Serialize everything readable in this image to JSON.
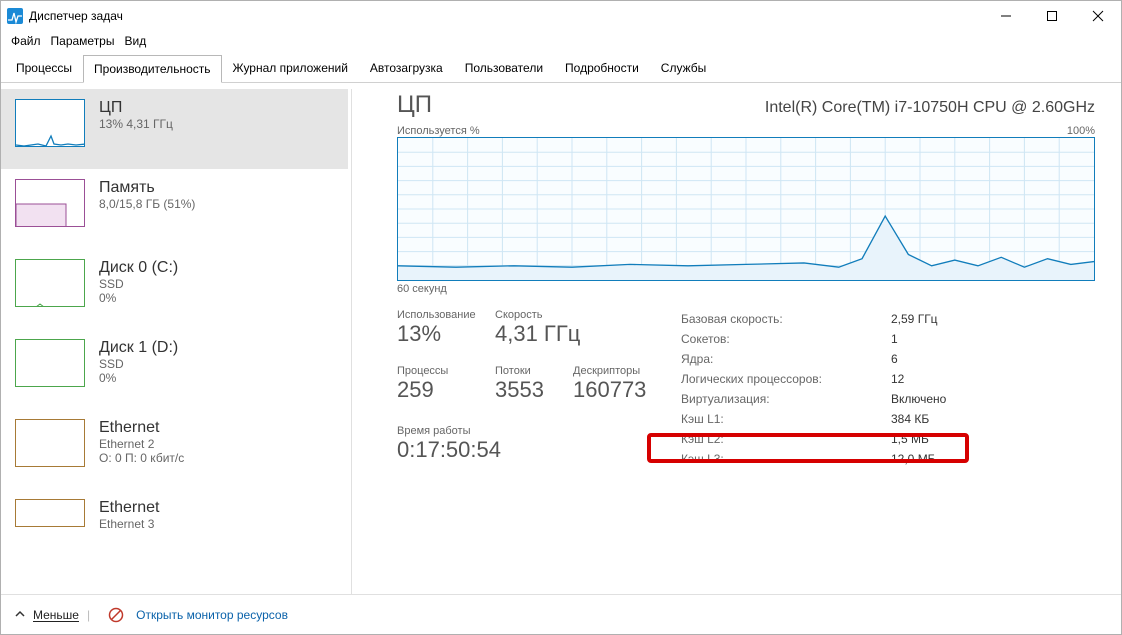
{
  "window": {
    "title": "Диспетчер задач"
  },
  "menu": {
    "file": "Файл",
    "options": "Параметры",
    "view": "Вид"
  },
  "tabs": {
    "processes": "Процессы",
    "performance": "Производительность",
    "apphistory": "Журнал приложений",
    "startup": "Автозагрузка",
    "users": "Пользователи",
    "details": "Подробности",
    "services": "Службы"
  },
  "sidebar": [
    {
      "name": "cpu",
      "title": "ЦП",
      "sub1": "13% 4,31 ГГц",
      "sub2": ""
    },
    {
      "name": "mem",
      "title": "Память",
      "sub1": "8,0/15,8 ГБ (51%)",
      "sub2": ""
    },
    {
      "name": "disk0",
      "title": "Диск 0 (C:)",
      "sub1": "SSD",
      "sub2": "0%"
    },
    {
      "name": "disk1",
      "title": "Диск 1 (D:)",
      "sub1": "SSD",
      "sub2": "0%"
    },
    {
      "name": "eth2",
      "title": "Ethernet",
      "sub1": "Ethernet 2",
      "sub2": "О: 0 П: 0 кбит/с"
    },
    {
      "name": "eth3",
      "title": "Ethernet",
      "sub1": "Ethernet 3",
      "sub2": ""
    }
  ],
  "cpu": {
    "heading": "ЦП",
    "model": "Intel(R) Core(TM) i7-10750H CPU @ 2.60GHz",
    "util_label": "Используется %",
    "util_max": "100%",
    "time_axis": "60 секунд",
    "stats": {
      "usage_label": "Использование",
      "usage_value": "13%",
      "speed_label": "Скорость",
      "speed_value": "4,31 ГГц",
      "proc_label": "Процессы",
      "proc_value": "259",
      "thread_label": "Потоки",
      "thread_value": "3553",
      "handle_label": "Дескрипторы",
      "handle_value": "160773",
      "uptime_label": "Время работы",
      "uptime_value": "0:17:50:54"
    },
    "props": {
      "base_label": "Базовая скорость:",
      "base_value": "2,59 ГГц",
      "sockets_label": "Сокетов:",
      "sockets_value": "1",
      "cores_label": "Ядра:",
      "cores_value": "6",
      "lp_label": "Логических процессоров:",
      "lp_value": "12",
      "virt_label": "Виртуализация:",
      "virt_value": "Включено",
      "l1_label": "Кэш L1:",
      "l1_value": "384 КБ",
      "l2_label": "Кэш L2:",
      "l2_value": "1,5 МБ",
      "l3_label": "Кэш L3:",
      "l3_value": "12,0 МБ"
    }
  },
  "footer": {
    "less": "Меньше",
    "resmon": "Открыть монитор ресурсов"
  },
  "chart_data": {
    "type": "line",
    "title": "Используется %",
    "xlabel": "60 секунд",
    "ylabel": "%",
    "ylim": [
      0,
      100
    ],
    "x": [
      60,
      55,
      50,
      45,
      40,
      35,
      30,
      25,
      22,
      20,
      18,
      16,
      14,
      12,
      10,
      8,
      6,
      4,
      2,
      0
    ],
    "values": [
      10,
      9,
      10,
      9,
      11,
      10,
      11,
      12,
      9,
      15,
      45,
      18,
      10,
      14,
      10,
      16,
      9,
      15,
      11,
      13
    ]
  }
}
